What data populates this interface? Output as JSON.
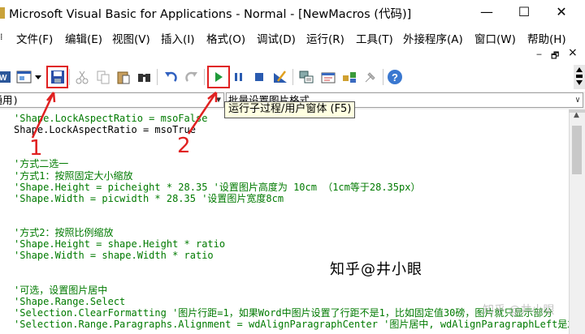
{
  "window": {
    "title": "Microsoft Visual Basic for Applications - Normal - [NewMacros (代码)]",
    "minimize": "—",
    "maximize": "☐",
    "close": "✕"
  },
  "menu": {
    "items": [
      "文件(F)",
      "编辑(E)",
      "视图(V)",
      "插入(I)",
      "格式(O)",
      "调试(D)",
      "运行(R)",
      "工具(T)",
      "外接程序(A)",
      "窗口(W)",
      "帮助(H)"
    ],
    "mdi_minimize": "‒",
    "mdi_restore": "🗗",
    "mdi_close": "×"
  },
  "toolbar": {
    "icons": [
      "word-icon",
      "insert-userform-icon",
      "dropdown-arrow-icon",
      "save-icon",
      "cut-icon",
      "copy-icon",
      "paste-icon",
      "find-icon",
      "undo-icon",
      "redo-icon",
      "run-icon",
      "break-icon",
      "reset-icon",
      "design-mode-icon",
      "project-explorer-icon",
      "properties-icon",
      "object-browser-icon",
      "toolbox-icon",
      "help-icon"
    ],
    "highlight_color": "#e02020"
  },
  "object_box": {
    "value": "(通用)"
  },
  "procedure_box": {
    "value": "批量设置图片格式"
  },
  "tooltip": {
    "text": "运行子过程/用户窗体 (F5)"
  },
  "annotations": {
    "label_1": "1",
    "label_2": "2"
  },
  "code_lines": [
    {
      "text": "'Shape.LockAspectRatio = msoFalse",
      "kind": "comment"
    },
    {
      "text": "Shape.LockAspectRatio = msoTrue",
      "kind": "code"
    },
    {
      "text": "",
      "kind": "code"
    },
    {
      "text": "",
      "kind": "code"
    },
    {
      "text": "'方式二选一",
      "kind": "comment"
    },
    {
      "text": "'方式1：按照固定大小缩放",
      "kind": "comment"
    },
    {
      "text": "'Shape.Height = picheight * 28.35 '设置图片高度为 10cm （1cm等于28.35px）",
      "kind": "comment"
    },
    {
      "text": "'Shape.Width = picwidth * 28.35 '设置图片宽度8cm",
      "kind": "comment"
    },
    {
      "text": "",
      "kind": "code"
    },
    {
      "text": "",
      "kind": "code"
    },
    {
      "text": "'方式2：按照比例缩放",
      "kind": "comment"
    },
    {
      "text": "'Shape.Height = shape.Height * ratio",
      "kind": "comment"
    },
    {
      "text": "'Shape.Width = shape.Width * ratio",
      "kind": "comment"
    },
    {
      "text": "",
      "kind": "code"
    },
    {
      "text": "",
      "kind": "code"
    },
    {
      "text": "'可选，设置图片居中",
      "kind": "comment"
    },
    {
      "text": "'Shape.Range.Select",
      "kind": "comment"
    },
    {
      "text": "'Selection.ClearFormatting '图片行距=1，如果Word中图片设置了行距不是1，比如固定值30磅，图片就只显示部分",
      "kind": "comment"
    },
    {
      "text": "'Selection.Range.Paragraphs.Alignment = wdAlignParagraphCenter '图片居中, wdAlignParagraphLeft是左对齐",
      "kind": "comment"
    }
  ],
  "watermark": {
    "text": "知乎@井小眼",
    "faint_text": "知乎 @井小眼"
  }
}
